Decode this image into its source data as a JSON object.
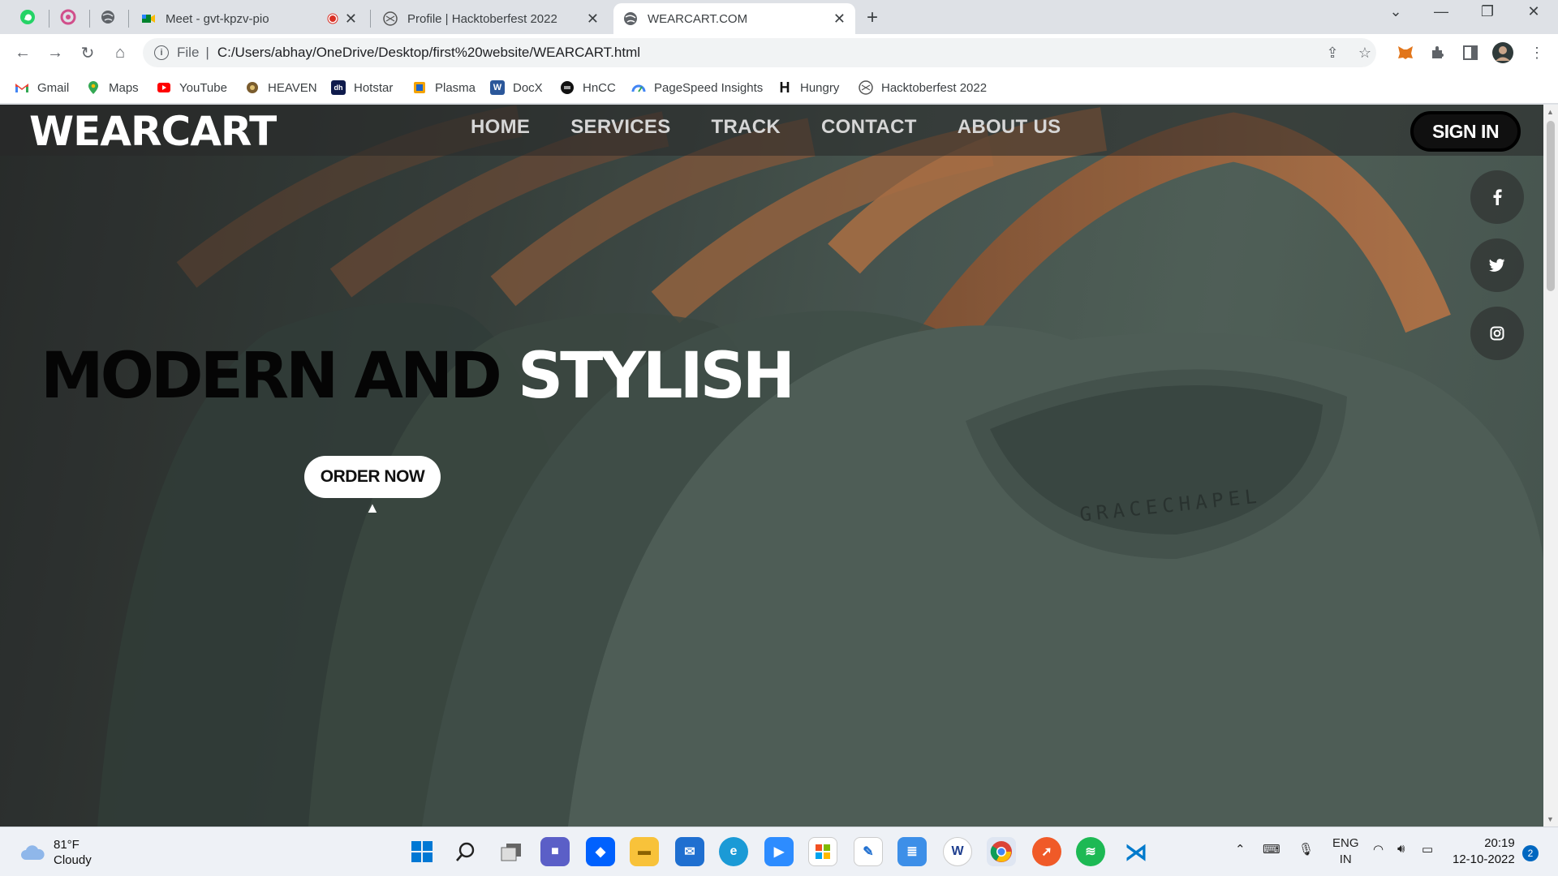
{
  "browser": {
    "tabs": [
      {
        "title": "Meet - gvt-kpzv-pio",
        "icon": "google-meet-icon"
      },
      {
        "title": "Profile | Hacktoberfest 2022",
        "icon": "hacktoberfest-icon"
      },
      {
        "title": "WEARCART.COM",
        "icon": "globe-icon",
        "active": true
      }
    ],
    "address": {
      "scheme": "File",
      "url": "C:/Users/abhay/OneDrive/Desktop/first%20website/WEARCART.html"
    },
    "bookmarks": [
      {
        "label": "Gmail",
        "icon": "gmail-icon",
        "color": "#ea4335"
      },
      {
        "label": "Maps",
        "icon": "maps-icon",
        "color": "#34a853"
      },
      {
        "label": "YouTube",
        "icon": "youtube-icon",
        "color": "#ff0000"
      },
      {
        "label": "HEAVEN",
        "icon": "heaven-icon",
        "color": "#7a5c2e"
      },
      {
        "label": "Hotstar",
        "icon": "hotstar-icon",
        "color": "#0f1b4c"
      },
      {
        "label": "Plasma",
        "icon": "plasma-icon",
        "color": "#f4a300"
      },
      {
        "label": "DocX",
        "icon": "word-icon",
        "color": "#2b579a"
      },
      {
        "label": "HnCC",
        "icon": "hncc-icon",
        "color": "#111111"
      },
      {
        "label": "PageSpeed Insights",
        "icon": "pagespeed-icon",
        "color": "#4285f4"
      },
      {
        "label": "Hungry",
        "icon": "hungry-icon",
        "color": "#111111"
      },
      {
        "label": "Hacktoberfest 2022",
        "icon": "hacktoberfest-icon",
        "color": "#555555"
      }
    ]
  },
  "site": {
    "logo": "WEARCART",
    "nav": [
      "HOME",
      "SERVICES",
      "TRACK",
      "CONTACT",
      "ABOUT US"
    ],
    "signin": "SIGN IN",
    "headline_dark": "MODERN AND",
    "headline_light": "STYLISH",
    "cta": "ORDER NOW",
    "shirt_label": "GRACECHAPEL",
    "social": [
      "facebook-icon",
      "twitter-icon",
      "instagram-icon"
    ]
  },
  "taskbar": {
    "weather_temp": "81°F",
    "weather_desc": "Cloudy",
    "lang_1": "ENG",
    "lang_2": "IN",
    "time": "20:19",
    "date": "12-10-2022",
    "notifications": "2"
  }
}
